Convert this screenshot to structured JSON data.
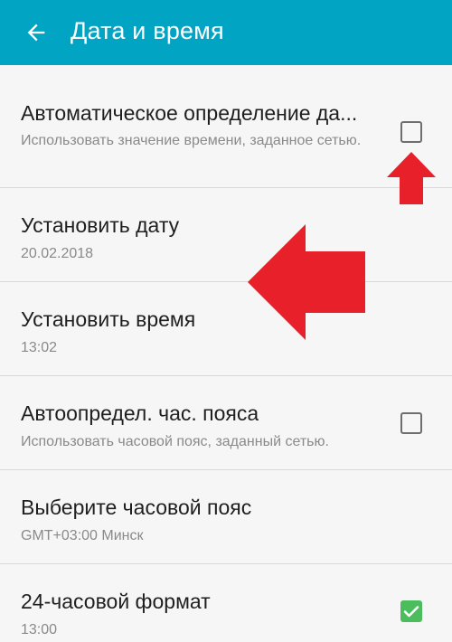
{
  "header": {
    "title": "Дата и время",
    "back_icon": "arrow-left-icon",
    "background": "#02a4c4"
  },
  "settings": [
    {
      "title": "Автоматическое определение да...",
      "subtitle": "Использовать значение времени, заданное сетью.",
      "control": "checkbox",
      "checked": false
    },
    {
      "title": "Установить дату",
      "subtitle": "20.02.2018"
    },
    {
      "title": "Установить время",
      "subtitle": "13:02"
    },
    {
      "title": "Автоопредел. час. пояса",
      "subtitle": "Использовать часовой пояс, заданный сетью.",
      "control": "checkbox",
      "checked": false
    },
    {
      "title": "Выберите часовой пояс",
      "subtitle": "GMT+03:00 Минск"
    },
    {
      "title": "24-часовой формат",
      "subtitle": "13:00",
      "control": "checkbox",
      "checked": true
    }
  ],
  "annotations": {
    "arrow_color": "#e8202a",
    "checked_color": "#4cbd5c"
  }
}
